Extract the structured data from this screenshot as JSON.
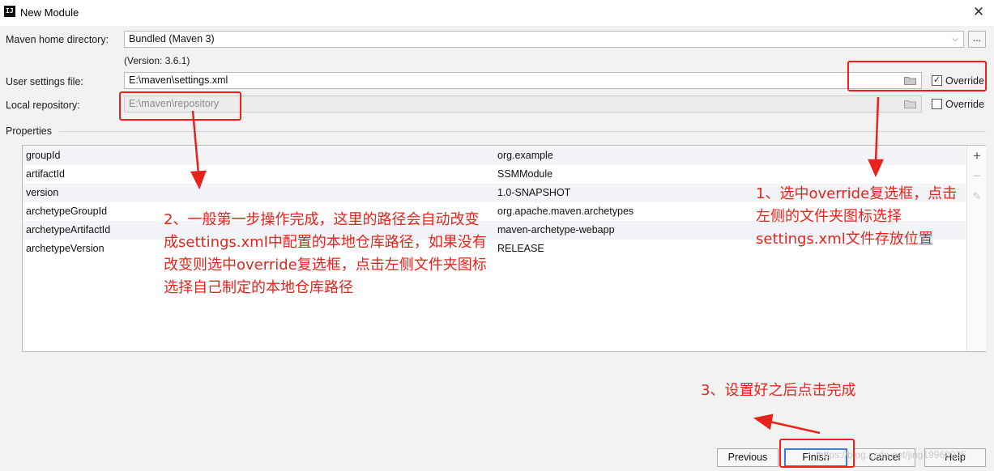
{
  "window": {
    "title": "New Module",
    "app_icon": "IJ",
    "close_glyph": "✕"
  },
  "maven": {
    "home_label": "Maven home directory:",
    "home_value": "Bundled (Maven 3)",
    "browse_label": "...",
    "version": "(Version: 3.6.1)",
    "settings_label": "User settings file:",
    "settings_value": "E:\\maven\\settings.xml",
    "settings_override_label": "Override",
    "settings_override_checked": true,
    "repo_label": "Local repository:",
    "repo_value": "E:\\maven\\repository",
    "repo_override_label": "Override",
    "repo_override_checked": false
  },
  "properties": {
    "section_label": "Properties",
    "rows": [
      {
        "key": "groupId",
        "value": "org.example"
      },
      {
        "key": "artifactId",
        "value": "SSMModule"
      },
      {
        "key": "version",
        "value": "1.0-SNAPSHOT"
      },
      {
        "key": "archetypeGroupId",
        "value": "org.apache.maven.archetypes"
      },
      {
        "key": "archetypeArtifactId",
        "value": "maven-archetype-webapp"
      },
      {
        "key": "archetypeVersion",
        "value": "RELEASE"
      }
    ],
    "add_glyph": "+",
    "remove_glyph": "−",
    "edit_glyph": "✎"
  },
  "buttons": {
    "previous": "Previous",
    "finish": "Finish",
    "cancel": "Cancel",
    "help": "Help"
  },
  "annotations": {
    "note1": [
      "1、选中override复选框，点击",
      "左侧的文件夹图标选择",
      "settings.xml文件存放位置"
    ],
    "note2": [
      "2、一般第一步操作完成，这里的路径会自动改变",
      "成settings.xml中配置的本地仓库路径，如果没有",
      "改变则选中override复选框，点击左侧文件夹图标",
      "选择自己制定的本地仓库路径"
    ],
    "note3": "3、设置好之后点击完成"
  },
  "watermark": "https://blog.csdn.net/jing19960925",
  "colors": {
    "annotation_red": "#e8231d",
    "default_button_border": "#3c7fd1"
  }
}
